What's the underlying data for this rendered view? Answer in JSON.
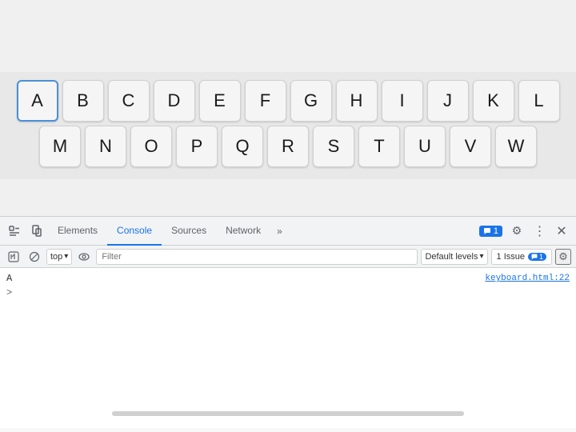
{
  "browser": {
    "top_height": 90
  },
  "keyboard": {
    "row1": [
      "A",
      "B",
      "C",
      "D",
      "E",
      "F",
      "G",
      "H",
      "I",
      "J",
      "K",
      "L"
    ],
    "row2": [
      "M",
      "N",
      "O",
      "P",
      "Q",
      "R",
      "S",
      "T",
      "U",
      "V",
      "W"
    ],
    "active_key": "A"
  },
  "devtools": {
    "tabs": [
      {
        "label": "Elements",
        "active": false
      },
      {
        "label": "Console",
        "active": true
      },
      {
        "label": "Sources",
        "active": false
      },
      {
        "label": "Network",
        "active": false
      }
    ],
    "more_label": "»",
    "badge_count": "1",
    "settings_icon": "⚙",
    "more_icon": "⋮",
    "close_icon": "✕",
    "inspect_icon": "⬚",
    "device_icon": "□"
  },
  "console_toolbar": {
    "execute_icon": "▶",
    "block_icon": "⊘",
    "context_label": "top",
    "context_arrow": "▾",
    "eye_icon": "👁",
    "filter_placeholder": "Filter",
    "default_levels_label": "Default levels",
    "dropdown_arrow": "▾",
    "issue_label": "1 Issue",
    "settings_icon": "⚙"
  },
  "console_output": {
    "lines": [
      {
        "text": "A",
        "source": "keyboard.html:22"
      }
    ],
    "prompt_symbol": ">"
  },
  "scrollbar": {
    "visible": true
  }
}
